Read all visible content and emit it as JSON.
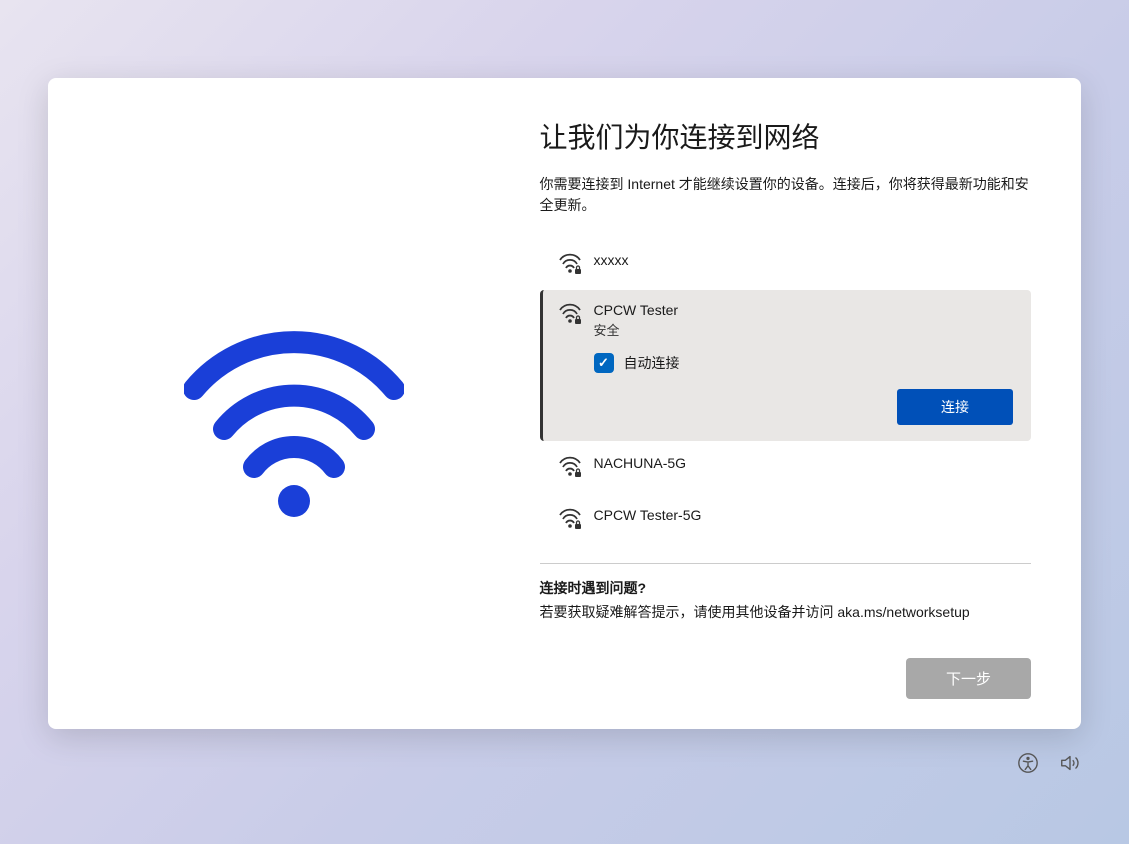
{
  "title": "让我们为你连接到网络",
  "subtitle": "你需要连接到 Internet 才能继续设置你的设备。连接后，你将获得最新功能和安全更新。",
  "networks": [
    {
      "name": "xxxxx",
      "secured": true,
      "selected": false
    },
    {
      "name": "CPCW Tester",
      "secured": true,
      "selected": true,
      "security_label": "安全"
    },
    {
      "name": "NACHUNA-5G",
      "secured": true,
      "selected": false
    },
    {
      "name": "CPCW Tester-5G",
      "secured": true,
      "selected": false
    }
  ],
  "auto_connect_label": "自动连接",
  "auto_connect_checked": true,
  "connect_button": "连接",
  "help": {
    "title": "连接时遇到问题?",
    "text": "若要获取疑难解答提示，请使用其他设备并访问 aka.ms/networksetup"
  },
  "next_button": "下一步"
}
